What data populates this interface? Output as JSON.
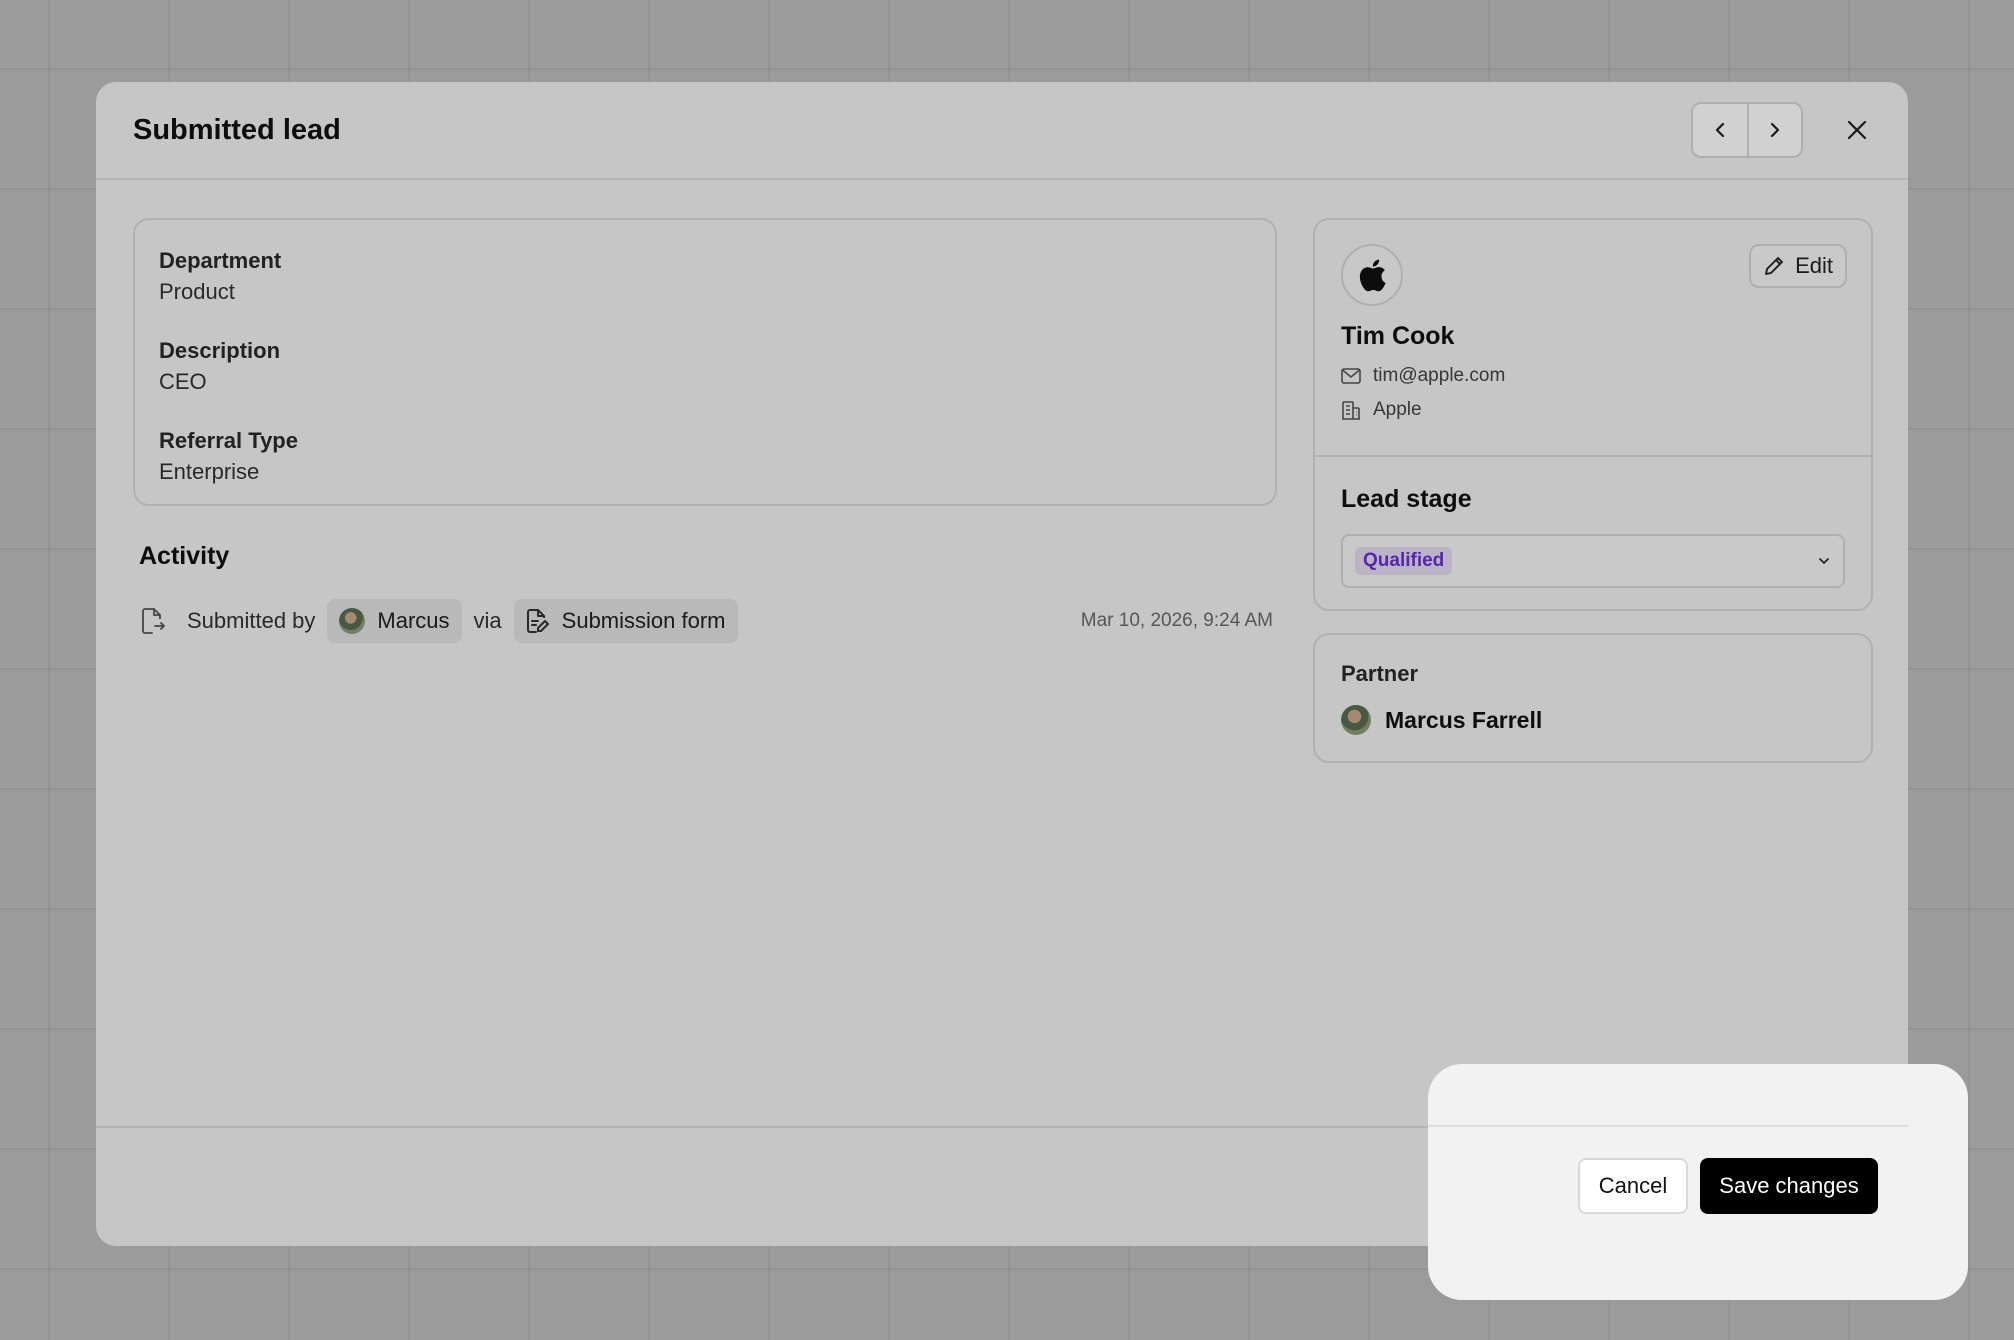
{
  "modal": {
    "title": "Submitted lead"
  },
  "details": {
    "fields": [
      {
        "label": "Department",
        "value": "Product"
      },
      {
        "label": "Description",
        "value": "CEO"
      },
      {
        "label": "Referral Type",
        "value": "Enterprise"
      }
    ]
  },
  "activity": {
    "title": "Activity",
    "submitted_by_label": "Submitted by",
    "user": "Marcus",
    "via_label": "via",
    "source": "Submission form",
    "timestamp": "Mar 10, 2026, 9:24 AM"
  },
  "contact": {
    "name": "Tim Cook",
    "email": "tim@apple.com",
    "company": "Apple",
    "edit_label": "Edit"
  },
  "lead_stage": {
    "title": "Lead stage",
    "selected": "Qualified",
    "badge_color": "#6a2fd6"
  },
  "partner": {
    "label": "Partner",
    "name": "Marcus Farrell"
  },
  "footer": {
    "cancel_label": "Cancel",
    "save_label": "Save changes"
  },
  "icons": {
    "prev": "chevron-left-icon",
    "next": "chevron-right-icon",
    "close": "close-icon",
    "edit": "pencil-icon",
    "email": "mail-icon",
    "company": "building-icon",
    "logo": "apple-logo-icon",
    "dropdown": "chevron-down-icon",
    "activity": "file-export-icon",
    "form": "form-edit-icon"
  }
}
